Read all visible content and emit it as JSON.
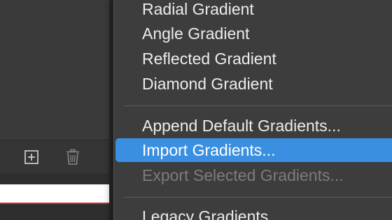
{
  "left_panel": {
    "add_icon": "plus-square-icon",
    "trash_icon": "trash-icon"
  },
  "menu": {
    "group1": [
      {
        "label": "Radial Gradient"
      },
      {
        "label": "Angle Gradient"
      },
      {
        "label": "Reflected Gradient"
      },
      {
        "label": "Diamond Gradient"
      }
    ],
    "group2": [
      {
        "label": "Append Default Gradients..."
      },
      {
        "label": "Import Gradients...",
        "state": "highlighted"
      },
      {
        "label": "Export Selected Gradients...",
        "state": "disabled"
      }
    ],
    "group3": [
      {
        "label": "Legacy Gradients"
      }
    ]
  },
  "colors": {
    "highlight": "#3b8fe0",
    "menu_bg": "#3d3d3e",
    "disabled_text": "#7c7c7c",
    "accent_red_line": "#c83a3a"
  }
}
